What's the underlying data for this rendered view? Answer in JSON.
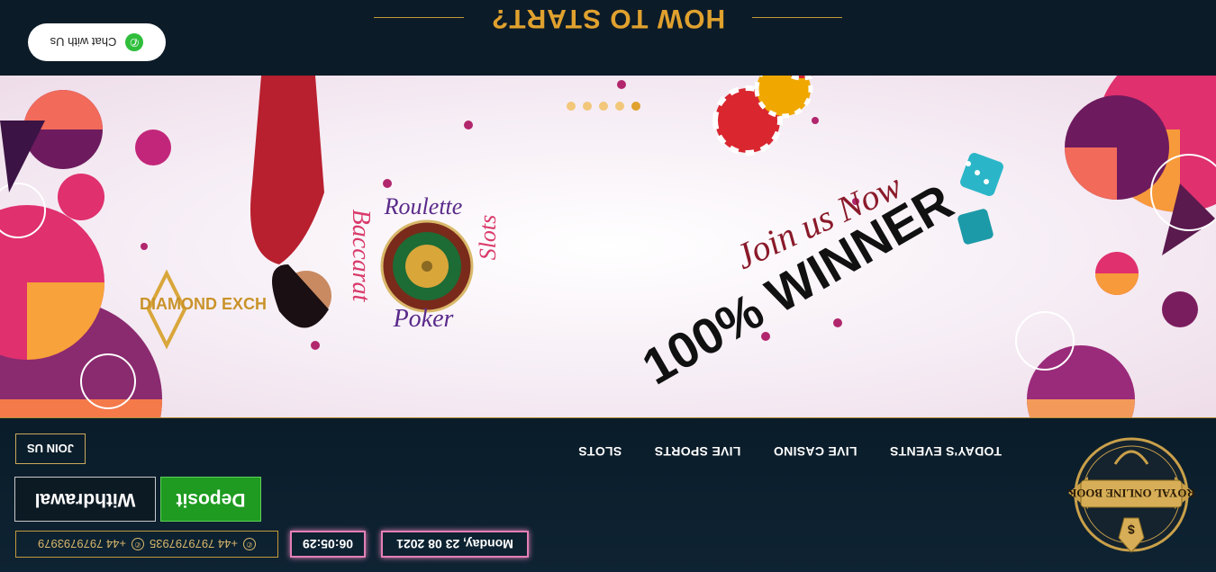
{
  "header": {
    "logo_text": "ROYAL ONLINE BOOK",
    "date": "Monday, 23 08 2021",
    "time": "06:05:29",
    "contacts": [
      "+44 7979797935",
      "+44 7979793979"
    ],
    "deposit_label": "Deposit",
    "withdrawal_label": "Withdrawal",
    "join_label": "JOIN US",
    "nav": [
      "TODAY'S EVENTS",
      "LIVE CASINO",
      "LIVE SPORTS",
      "SLOTS"
    ]
  },
  "banner": {
    "brand_text": "DIAMOND EXCH",
    "games": [
      "Poker",
      "Baccarat",
      "Slots",
      "Roulette"
    ],
    "headline": "100% WINNER",
    "tagline": "Join us Now",
    "slides": 5,
    "active_slide": 1
  },
  "section": {
    "how_title": "HOW TO START?"
  },
  "chat": {
    "label": "Chat with Us"
  },
  "colors": {
    "accent_gold": "#e0a12e",
    "deposit_green": "#1e9b20",
    "badge_pink": "#e47fb8",
    "header_bg": "#0e2333"
  }
}
